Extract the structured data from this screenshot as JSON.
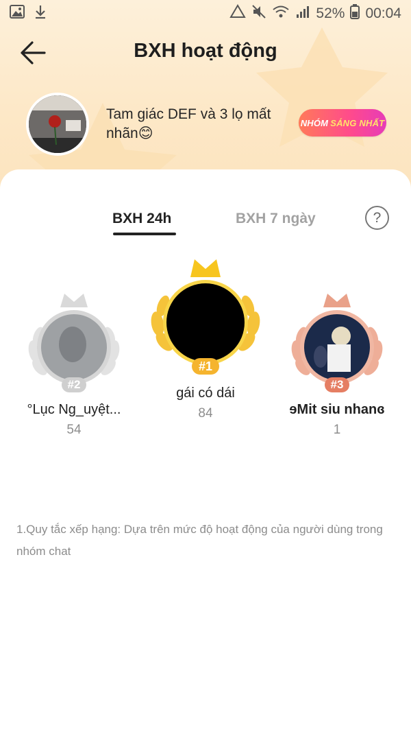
{
  "status_bar": {
    "battery": "52%",
    "time": "00:04",
    "icons": [
      "image-icon",
      "download-icon",
      "recycle-icon",
      "mute-icon",
      "wifi-icon",
      "signal-icon",
      "battery-icon"
    ]
  },
  "header": {
    "title": "BXH hoạt động",
    "back_icon": "back-arrow-icon"
  },
  "group": {
    "name": "Tam giác DEF và 3 lọ mất nhãn😊",
    "badge_part1": "NHÓM",
    "badge_part2": "SÁNG NHẤT"
  },
  "tabs": [
    {
      "label": "BXH 24h",
      "active": true
    },
    {
      "label": "BXH 7 ngày",
      "active": false
    }
  ],
  "help_label": "?",
  "leaderboard": [
    {
      "rank_label": "#1",
      "name": "gái có dái",
      "score": "84"
    },
    {
      "rank_label": "#2",
      "name": "°Lục Ng_uyệt...",
      "score": "54"
    },
    {
      "rank_label": "#3",
      "name": "ɘMit siu nhanɞ",
      "score": "1"
    }
  ],
  "rules_text": "1.Quy tắc xếp hạng: Dựa trên mức độ hoạt động của người dùng trong nhóm chat",
  "colors": {
    "gold": "#f7c51e",
    "silver": "#d6d6d6",
    "bronze": "#e9a189",
    "badge_gradient_start": "#ff7a59",
    "badge_gradient_end": "#e63cb8",
    "hero_bg": "#fde8c7"
  }
}
